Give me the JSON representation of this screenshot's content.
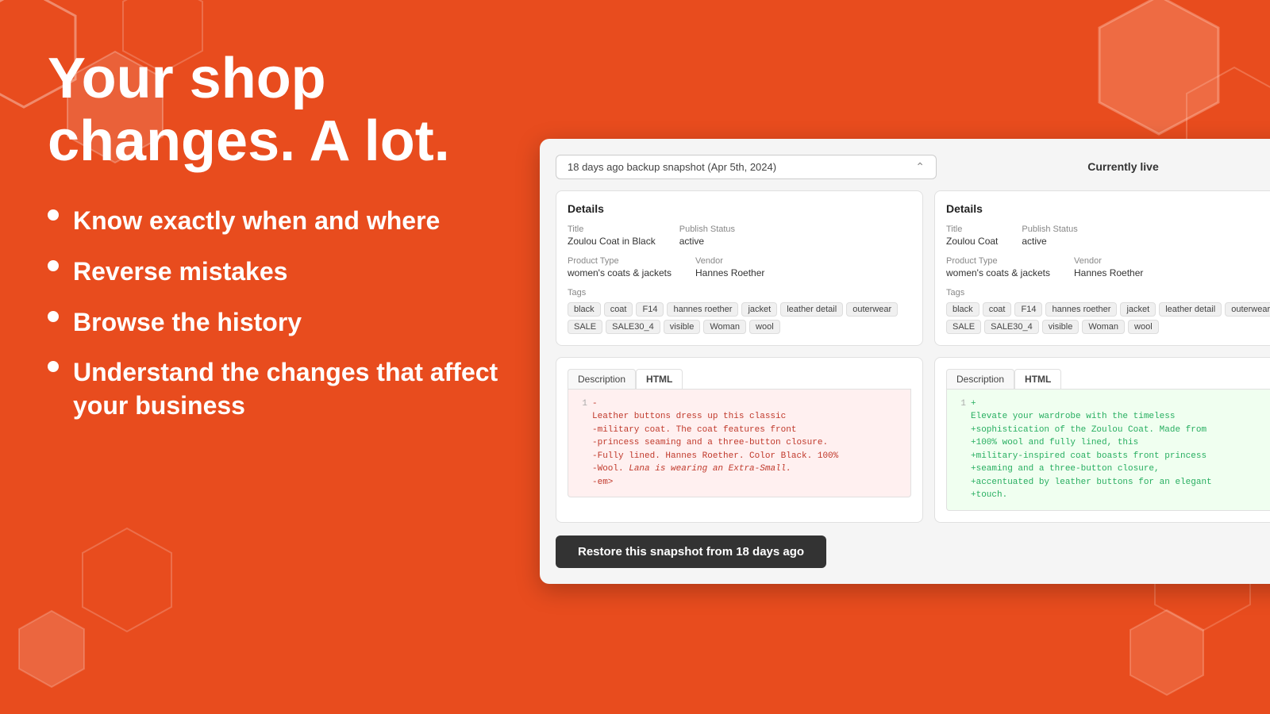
{
  "page": {
    "title": "Your shop changes. A lot.",
    "background_color": "#e84c1e"
  },
  "bullets": [
    {
      "id": "b1",
      "text": "Know exactly when and where"
    },
    {
      "id": "b2",
      "text": "Reverse mistakes"
    },
    {
      "id": "b3",
      "text": "Browse the history"
    },
    {
      "id": "b4",
      "text": "Understand the changes that affect your business"
    }
  ],
  "comparison": {
    "snapshot_label": "18 days ago backup snapshot (Apr 5th, 2024)",
    "live_label": "Currently live",
    "left": {
      "section_title": "Details",
      "title_label": "Title",
      "title_value": "Zoulou Coat in Black",
      "publish_status_label": "Publish Status",
      "publish_status_value": "active",
      "product_type_label": "Product Type",
      "product_type_value": "women's coats & jackets",
      "vendor_label": "Vendor",
      "vendor_value": "Hannes Roether",
      "tags_label": "Tags",
      "tags": [
        "black",
        "coat",
        "F14",
        "hannes roether",
        "jacket",
        "leather detail",
        "outerwear",
        "SALE",
        "SALE30_4",
        "visible",
        "Woman",
        "wool"
      ],
      "desc_tab_desc": "Description",
      "desc_tab_html": "HTML",
      "code_lines": [
        {
          "num": "1",
          "prefix": "-",
          "content": "<p>Leather buttons dress up this classic"
        },
        {
          "num": "",
          "prefix": "-",
          "content": "military coat. The coat features front"
        },
        {
          "num": "",
          "prefix": "-",
          "content": "princess seaming and a three-button closure."
        },
        {
          "num": "",
          "prefix": "-",
          "content": "Fully lined. Hannes Roether. Color Black. 100%"
        },
        {
          "num": "",
          "prefix": "-",
          "content": "Wool. <em>Lana is wearing an Extra-Small.</"
        },
        {
          "num": "",
          "prefix": "-",
          "content": "em></p>"
        }
      ]
    },
    "right": {
      "section_title": "Details",
      "title_label": "Title",
      "title_value": "Zoulou Coat",
      "publish_status_label": "Publish Status",
      "publish_status_value": "active",
      "product_type_label": "Product Type",
      "product_type_value": "women's coats & jackets",
      "vendor_label": "Vendor",
      "vendor_value": "Hannes Roether",
      "tags_label": "Tags",
      "tags": [
        "black",
        "coat",
        "F14",
        "hannes roether",
        "jacket",
        "leather detail",
        "outerwear",
        "SALE",
        "SALE30_4",
        "visible",
        "Woman",
        "wool"
      ],
      "desc_tab_desc": "Description",
      "desc_tab_html": "HTML",
      "code_lines": [
        {
          "num": "1",
          "prefix": "+",
          "content": "<p>Elevate your wardrobe with the timeless"
        },
        {
          "num": "",
          "prefix": "+",
          "content": "sophistication of the Zoulou Coat. Made from"
        },
        {
          "num": "",
          "prefix": "+",
          "content": "100% wool and fully lined, this"
        },
        {
          "num": "",
          "prefix": "+",
          "content": "military-inspired coat boasts front princess"
        },
        {
          "num": "",
          "prefix": "+",
          "content": "seaming and a three-button closure,"
        },
        {
          "num": "",
          "prefix": "+",
          "content": "accentuated by leather buttons for an elegant"
        },
        {
          "num": "",
          "prefix": "+",
          "content": "touch. <em></em></p>"
        }
      ]
    },
    "restore_btn_label": "Restore this snapshot from 18 days ago"
  }
}
